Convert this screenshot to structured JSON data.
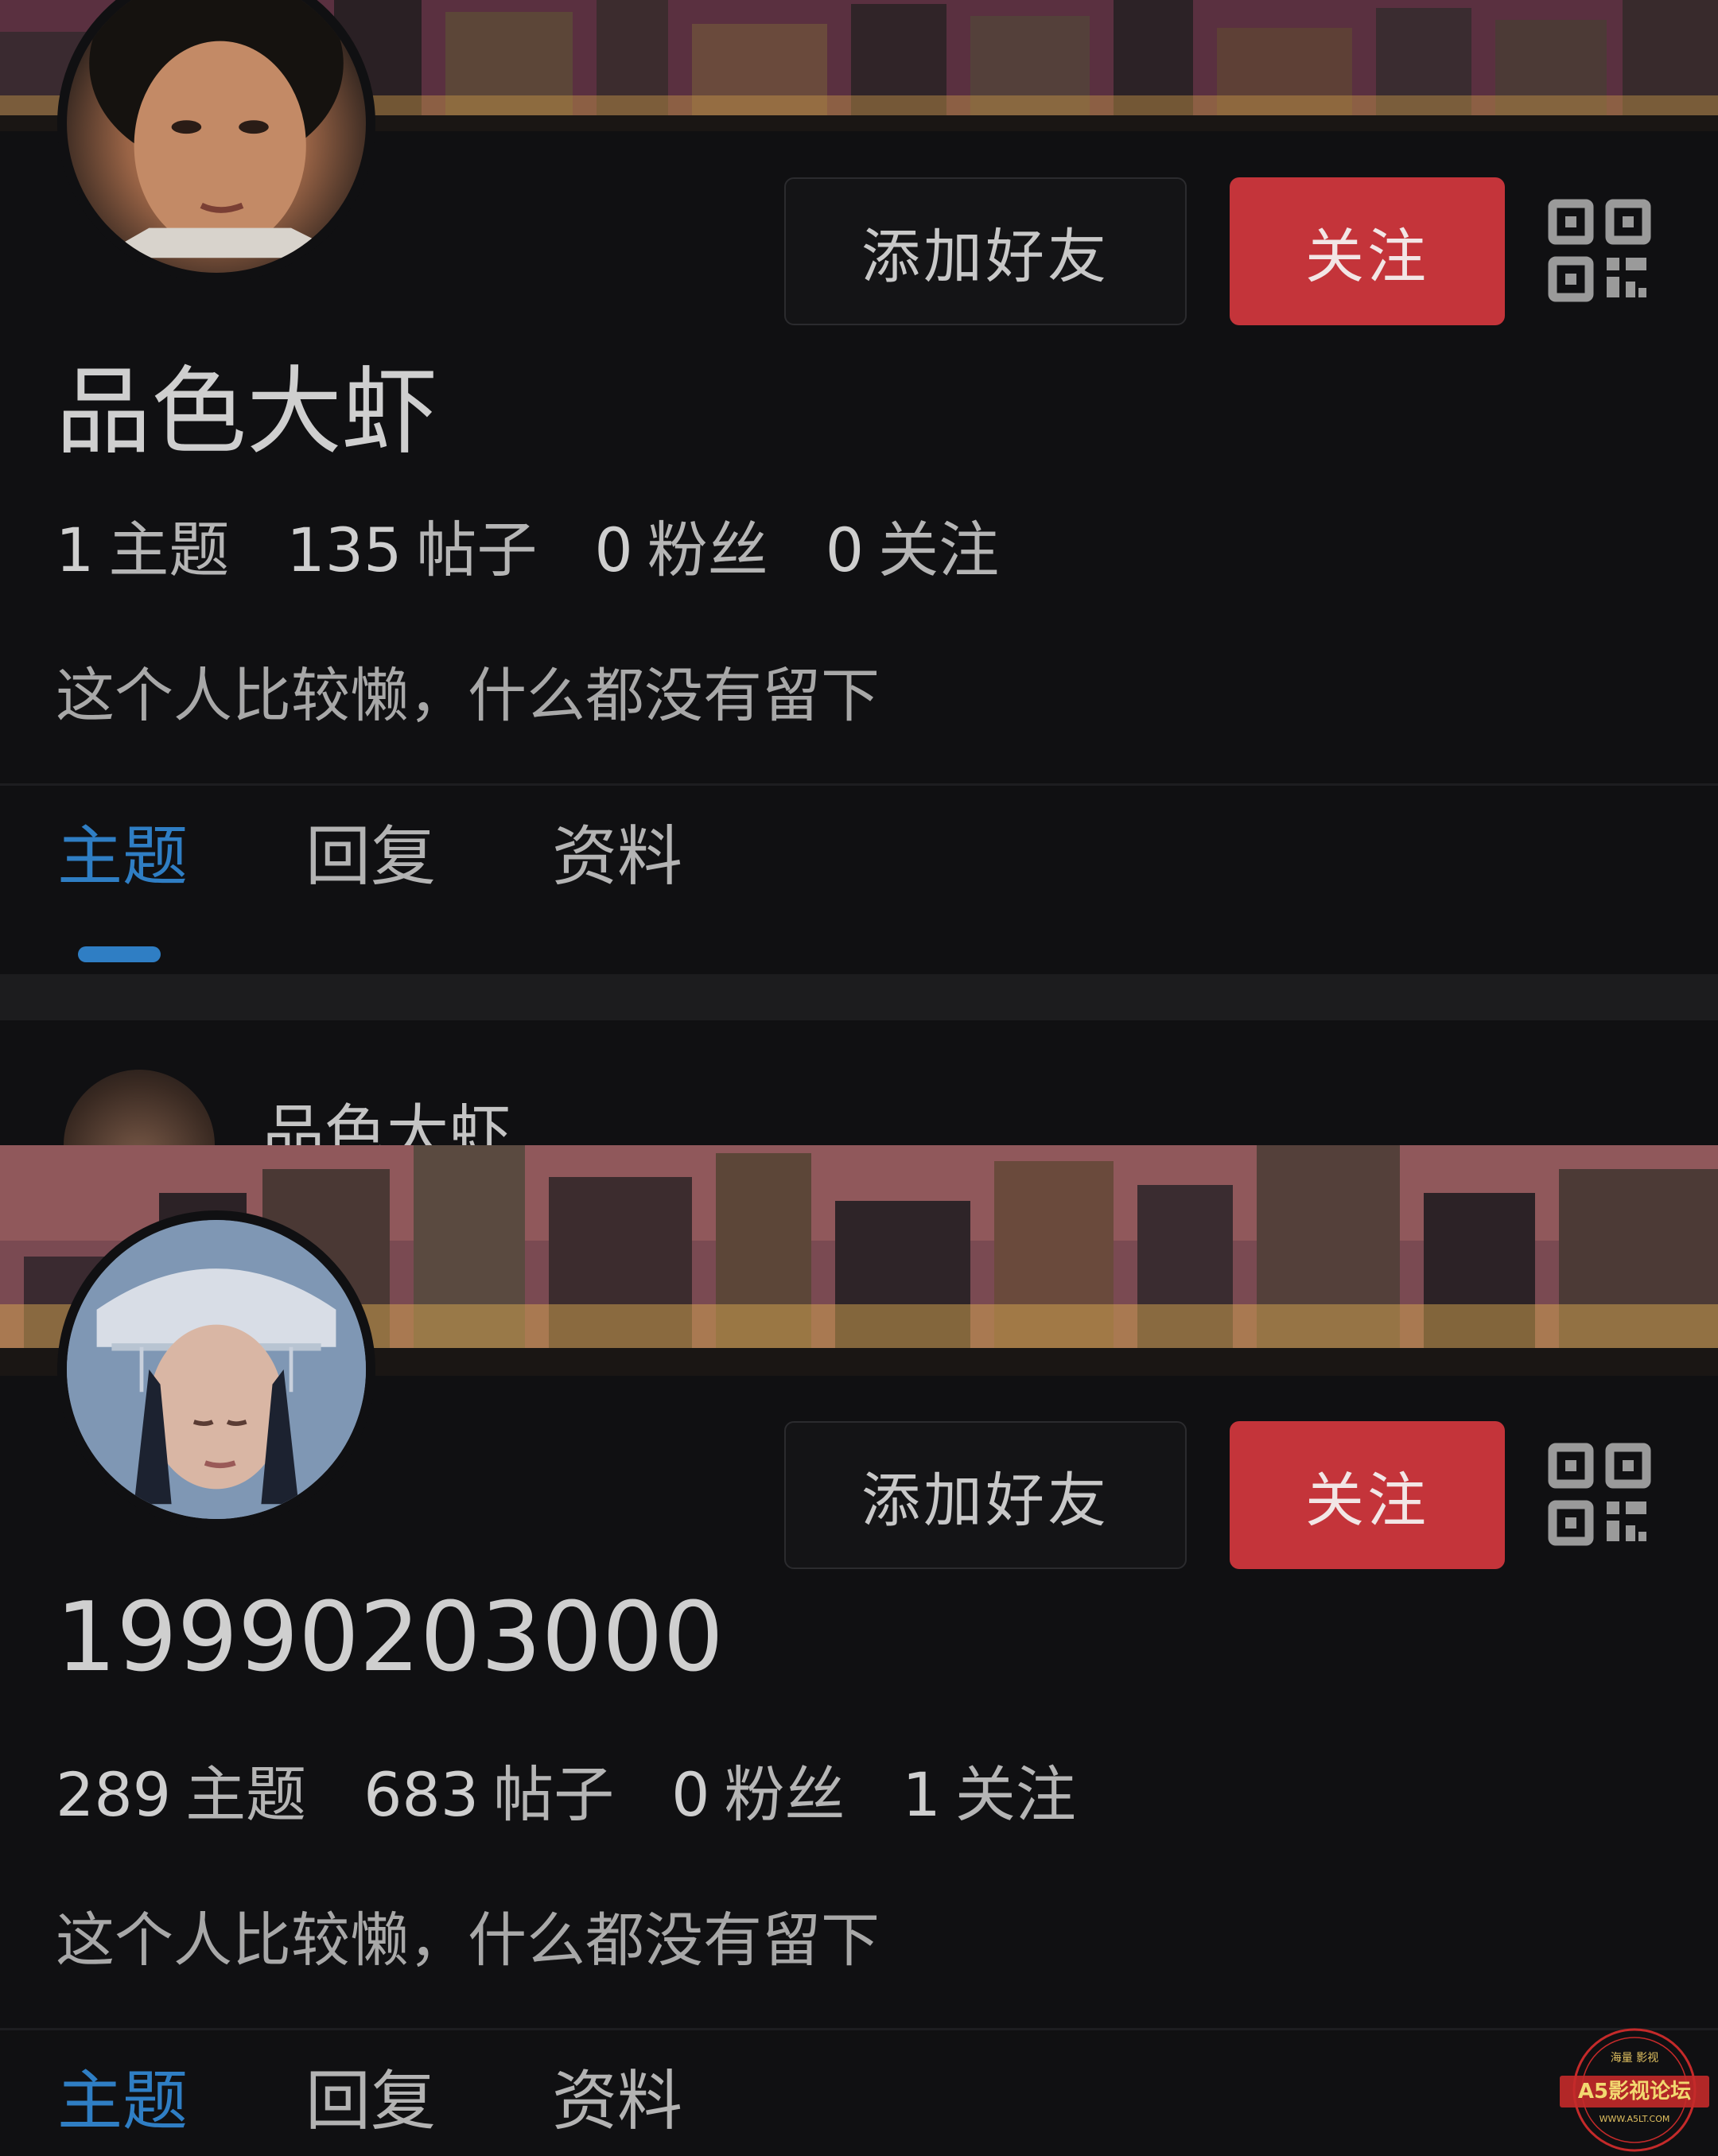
{
  "profiles": [
    {
      "username": "品色大虾",
      "buttons": {
        "add_friend": "添加好友",
        "follow": "关注"
      },
      "stats": [
        {
          "num": "1",
          "label": "主题"
        },
        {
          "num": "135",
          "label": "帖子"
        },
        {
          "num": "0",
          "label": "粉丝"
        },
        {
          "num": "0",
          "label": "关注"
        }
      ],
      "bio": "这个人比较懒，什么都没有留下",
      "tabs": [
        "主题",
        "回复",
        "资料"
      ],
      "active_tab": "主题",
      "post_preview_author": "品色大虾"
    },
    {
      "username": "19990203000",
      "buttons": {
        "add_friend": "添加好友",
        "follow": "关注"
      },
      "stats": [
        {
          "num": "289",
          "label": "主题"
        },
        {
          "num": "683",
          "label": "帖子"
        },
        {
          "num": "0",
          "label": "粉丝"
        },
        {
          "num": "1",
          "label": "关注"
        }
      ],
      "bio": "这个人比较懒，什么都没有留下",
      "tabs": [
        "主题",
        "回复",
        "资料"
      ],
      "active_tab": "主题"
    }
  ],
  "watermark": {
    "top": "海量 影视",
    "main": "A5影视论坛",
    "url": "WWW.A5LT.COM"
  },
  "colors": {
    "accent": "#2f7ec4",
    "follow_button": "#c4343a",
    "background": "#101012"
  },
  "icons": [
    "qr-code-icon"
  ]
}
